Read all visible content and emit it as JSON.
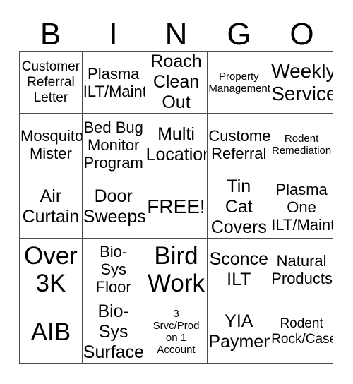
{
  "header": {
    "letters": [
      "B",
      "I",
      "N",
      "G",
      "O"
    ]
  },
  "grid": {
    "columns": 5,
    "rows": 5,
    "free_space": {
      "row": 2,
      "col": 2,
      "label": "FREE!"
    },
    "cells": [
      {
        "text": "Customer\nReferral\nLetter",
        "size": "sm"
      },
      {
        "text": "Plasma\nILT/Maint",
        "size": "md"
      },
      {
        "text": "Roach\nClean\nOut",
        "size": "lg"
      },
      {
        "text": "Property\nManagement",
        "size": "xs"
      },
      {
        "text": "Weekly\nService",
        "size": "xl"
      },
      {
        "text": "Mosquito\nMister",
        "size": "md"
      },
      {
        "text": "Bed Bug\nMonitor\nProgram",
        "size": "md"
      },
      {
        "text": "Multi\nLocation",
        "size": "lg"
      },
      {
        "text": "Customer\nReferral",
        "size": "md"
      },
      {
        "text": "Rodent\nRemediation",
        "size": "xs"
      },
      {
        "text": "Air\nCurtain",
        "size": "lg"
      },
      {
        "text": "Door\nSweeps",
        "size": "lg"
      },
      {
        "text": "FREE!",
        "size": "xl"
      },
      {
        "text": "Tin\nCat\nCovers",
        "size": "lg"
      },
      {
        "text": "Plasma\nOne\nILT/Maint",
        "size": "md"
      },
      {
        "text": "Over\n3K",
        "size": "xxl"
      },
      {
        "text": "Bio-\nSys\nFloor",
        "size": "md"
      },
      {
        "text": "Bird\nWork",
        "size": "xxl"
      },
      {
        "text": "Sconce\nILT",
        "size": "lg"
      },
      {
        "text": "Natural\nProducts",
        "size": "md"
      },
      {
        "text": "AIB",
        "size": "xxl"
      },
      {
        "text": "Bio-Sys\nSurface",
        "size": "lg"
      },
      {
        "text": "3\nSrvc/Prod\non 1\nAccount",
        "size": "xs"
      },
      {
        "text": "YIA\nPayment",
        "size": "lg"
      },
      {
        "text": "Rodent\nRock/Case",
        "size": "sm"
      }
    ]
  },
  "colors": {
    "background": "#ffffff",
    "text": "#000000",
    "grid_line": "#4d4d4d"
  }
}
